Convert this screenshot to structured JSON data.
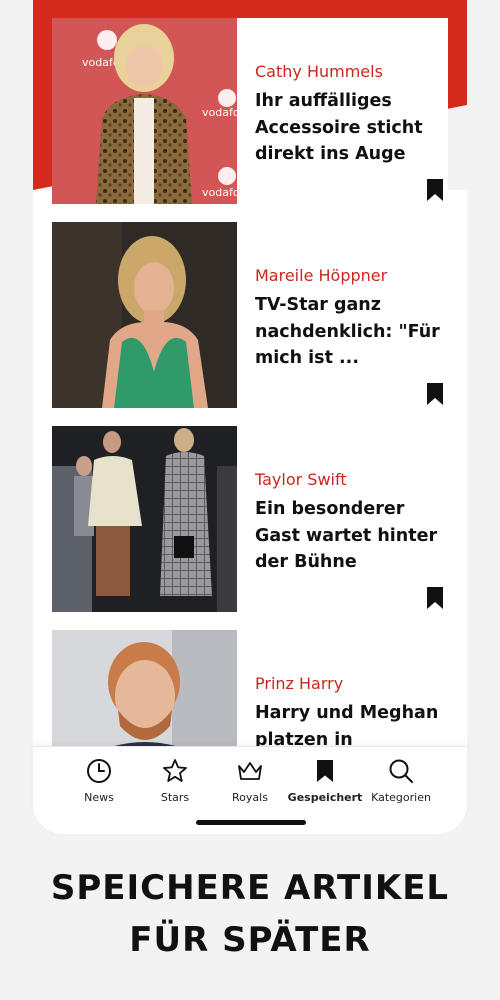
{
  "colors": {
    "accent": "#c8271d",
    "band": "#d42a1e",
    "text": "#111111"
  },
  "articles": [
    {
      "kicker": "Cathy Hummels",
      "headline": "Ihr auffälliges Accessoire sticht direkt ins Auge",
      "bookmark_icon": "bookmark-icon"
    },
    {
      "kicker": "Mareile Höppner",
      "headline": "TV-Star ganz nachdenklich: \"Für mich ist ...",
      "bookmark_icon": "bookmark-icon"
    },
    {
      "kicker": "Taylor Swift",
      "headline": "Ein besonderer Gast wartet hinter der Bühne",
      "bookmark_icon": "bookmark-icon"
    },
    {
      "kicker": "Prinz Harry",
      "headline": "Harry und Meghan platzen in",
      "bookmark_icon": "bookmark-icon"
    }
  ],
  "tabs": [
    {
      "label": "News",
      "icon": "clock-icon",
      "active": false
    },
    {
      "label": "Stars",
      "icon": "star-icon",
      "active": false
    },
    {
      "label": "Royals",
      "icon": "crown-icon",
      "active": false
    },
    {
      "label": "Gespeichert",
      "icon": "bookmark-icon",
      "active": true
    },
    {
      "label": "Kategorien",
      "icon": "search-icon",
      "active": false
    }
  ],
  "tagline": {
    "line1": "SPEICHERE ARTIKEL",
    "line2": "FÜR SPÄTER"
  },
  "photo_texts": {
    "brand": "vodafone"
  }
}
